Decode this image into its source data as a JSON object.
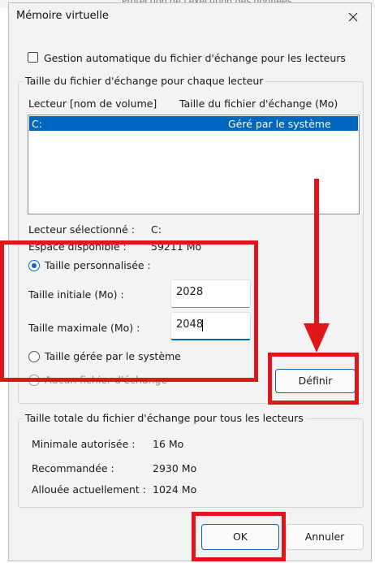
{
  "background_window": {
    "text": "Protection de l'exécution des données"
  },
  "dialog": {
    "title": "Mémoire virtuelle",
    "auto_manage_label": "Gestion automatique du fichier d'échange pour les lecteurs",
    "auto_manage_checked": false
  },
  "per_drive": {
    "group_title": "Taille du fichier d'échange pour chaque lecteur",
    "col_drive": "Lecteur [nom de volume]",
    "col_size": "Taille du fichier d'échange (Mo)",
    "rows": [
      {
        "drive": "C:",
        "size": "Géré par le système",
        "selected": true
      }
    ],
    "selected_drive_label": "Lecteur sélectionné :",
    "selected_drive_value": "C:",
    "free_space_label": "Espace disponible :",
    "free_space_value": "59211 Mo",
    "radio_custom": "Taille personnalisée :",
    "initial_label": "Taille initiale (Mo) :",
    "initial_value": "2028",
    "max_label": "Taille maximale (Mo) :",
    "max_value": "2048",
    "radio_system": "Taille gérée par le système",
    "radio_none": "Aucun fichier d'échange",
    "set_button": "Définir",
    "selected_option": "custom"
  },
  "total": {
    "group_title": "Taille totale du fichier d'échange pour tous les lecteurs",
    "min_label": "Minimale autorisée :",
    "min_value": "16 Mo",
    "recommended_label": "Recommandée :",
    "recommended_value": "2930 Mo",
    "allocated_label": "Allouée actuellement :",
    "allocated_value": "1024 Mo"
  },
  "buttons": {
    "ok": "OK",
    "cancel": "Annuler"
  },
  "colors": {
    "accent": "#0067c0",
    "annotation": "#e0161b",
    "dialog_bg": "#f3f3f3"
  },
  "icons": {
    "close": "close-icon",
    "arrow": "down-arrow-annotation"
  }
}
